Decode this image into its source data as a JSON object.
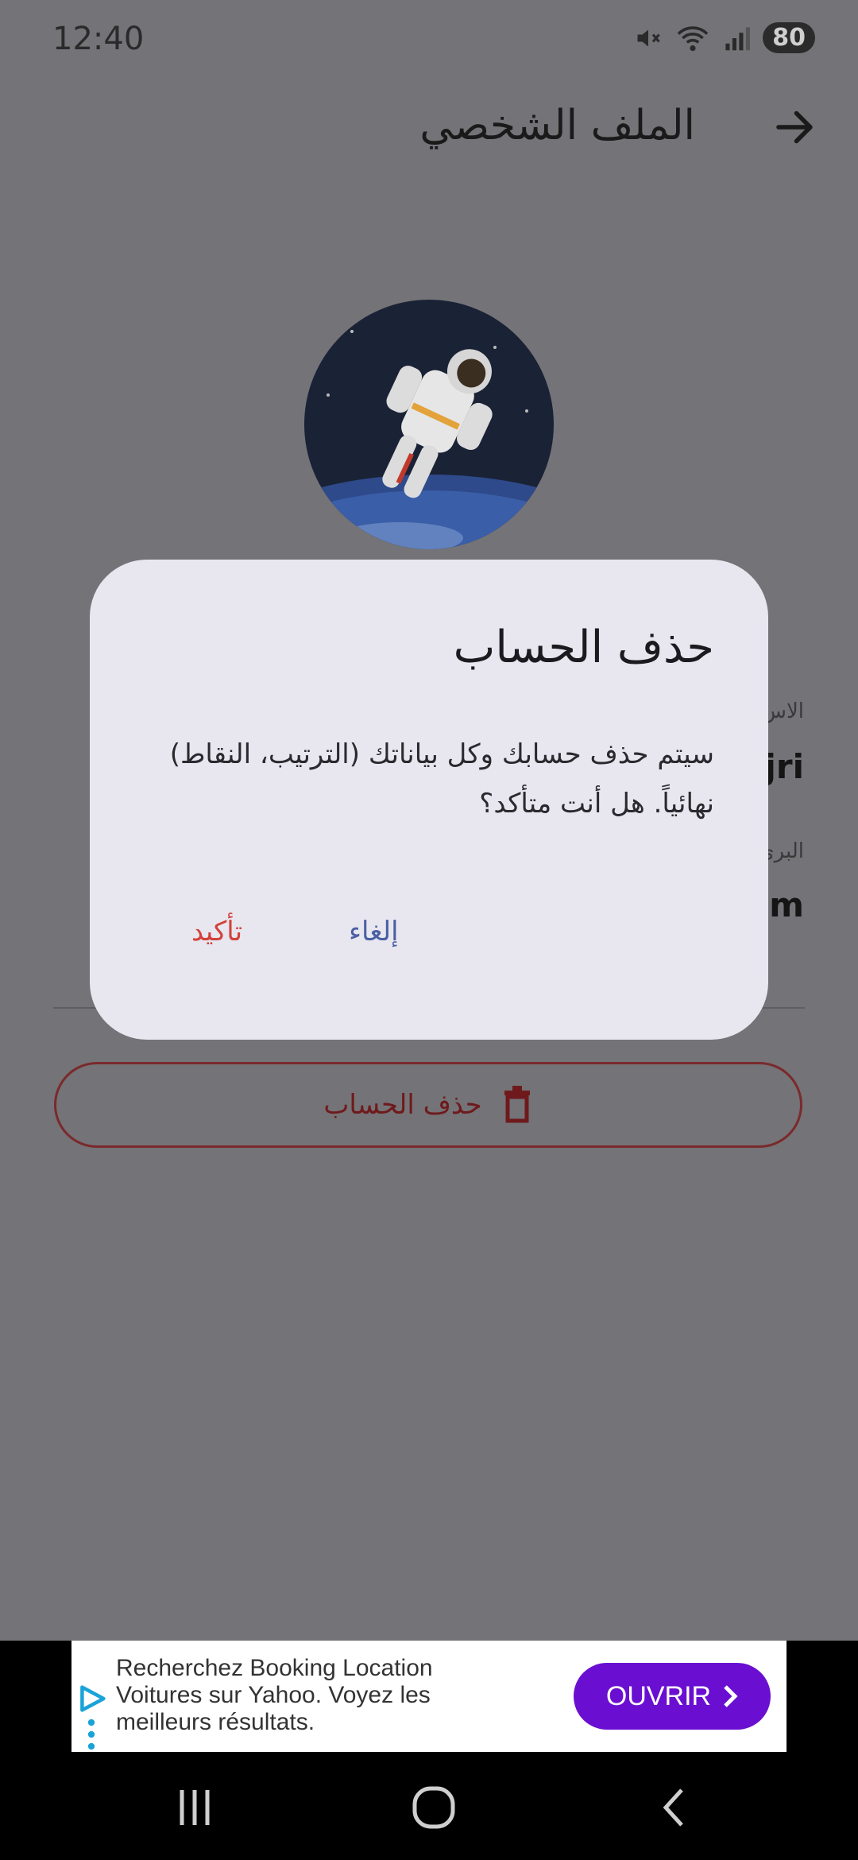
{
  "status_bar": {
    "time": "12:40",
    "battery": "80",
    "icons": [
      "mute-icon",
      "wifi-icon",
      "signal-icon",
      "battery-icon"
    ]
  },
  "app_bar": {
    "title": "الملف الشخصي",
    "back_icon": "arrow-right-icon"
  },
  "profile": {
    "name_label_partial": "الاس",
    "name_value_partial": "jri",
    "email_label_partial": "البري",
    "email_value_partial": "om"
  },
  "delete_button": {
    "label": "حذف الحساب",
    "icon": "trash-icon"
  },
  "dialog": {
    "title": "حذف الحساب",
    "message": "سيتم حذف حسابك وكل بياناتك (الترتيب، النقاط) نهائياً. هل أنت متأكد؟",
    "confirm_label": "تأكيد",
    "cancel_label": "إلغاء",
    "colors": {
      "confirm": "#d2413b",
      "cancel": "#4b5fa3"
    }
  },
  "ad": {
    "text": "Recherchez Booking Location Voitures sur Yahoo. Voyez les meilleurs résultats.",
    "button_label": "OUVRIR",
    "button_color": "#6a0fd1"
  },
  "nav_bar": {
    "buttons": [
      "recents-icon",
      "home-icon",
      "back-icon"
    ]
  }
}
